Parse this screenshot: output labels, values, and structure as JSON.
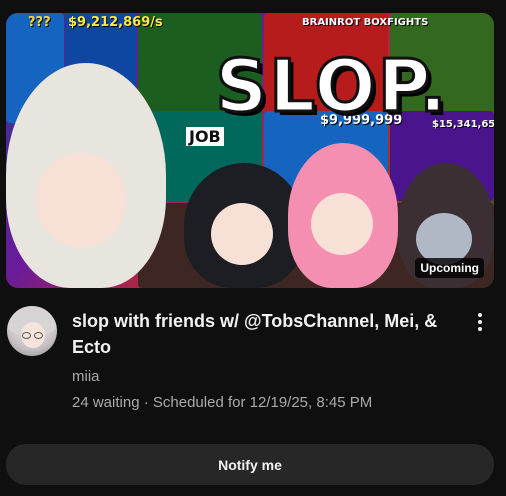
{
  "video": {
    "thumbnail_text": "SLOP.",
    "thumbnail_tiles": [
      {
        "text": "???",
        "color": "#fdd835"
      },
      {
        "text": "$9,212,869/s",
        "color": "#ffeb3b"
      },
      {
        "text": "BRAINROT BOXFIGHTS",
        "color": "#ffffff"
      },
      {
        "text": "JOB",
        "color": "#ffffff"
      },
      {
        "text": "$9,999,999",
        "color": "#ffffff"
      },
      {
        "text": "$15,341,65",
        "color": "#ffffff"
      }
    ],
    "badge": "Upcoming",
    "title": "slop with friends w/ @TobsChannel, Mei, & Ecto",
    "channel": "miia",
    "waiting": "24 waiting",
    "separator": " · ",
    "scheduled": "Scheduled for 12/19/25, 8:45 PM"
  },
  "actions": {
    "more_icon": "three-dots-vertical-icon",
    "notify_label": "Notify me"
  },
  "colors": {
    "background": "#0f0f0f",
    "text_primary": "#f1f1f1",
    "text_secondary": "#aaaaaa",
    "button_bg": "#272727"
  }
}
